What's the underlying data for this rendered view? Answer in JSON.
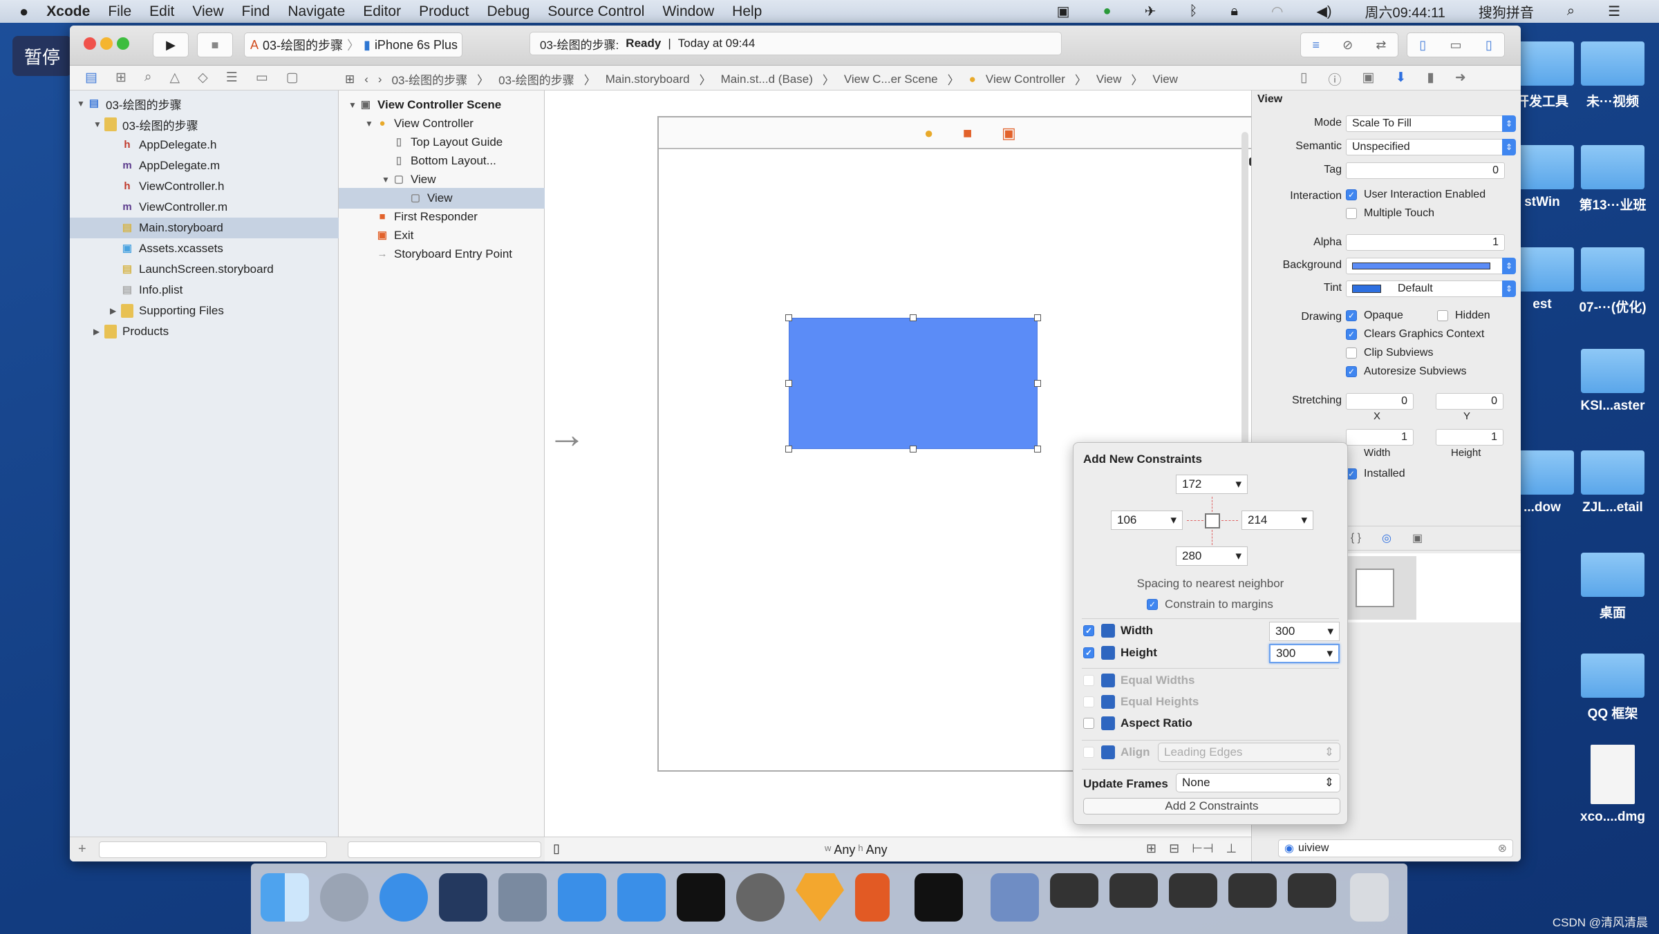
{
  "menubar": {
    "app": "Xcode",
    "items": [
      "File",
      "Edit",
      "View",
      "Find",
      "Navigate",
      "Editor",
      "Product",
      "Debug",
      "Source Control",
      "Window",
      "Help"
    ],
    "clock": "周六09:44:11",
    "input_method": "搜狗拼音"
  },
  "overlay": {
    "pause_label": "暂停"
  },
  "toolbar": {
    "scheme": "03-绘图的步骤",
    "device": "iPhone 6s Plus",
    "status_project": "03-绘图的步骤:",
    "status_state": "Ready",
    "status_time": "Today at 09:44"
  },
  "breadcrumb": [
    "03-绘图的步骤",
    "03-绘图的步骤",
    "Main.storyboard",
    "Main.st...d (Base)",
    "View C...er Scene",
    "View Controller",
    "View",
    "View"
  ],
  "navigator": {
    "items": [
      {
        "label": "03-绘图的步骤",
        "icon": "project-icon",
        "level": 0,
        "disclosure": "open"
      },
      {
        "label": "03-绘图的步骤",
        "icon": "folder-icon",
        "level": 1,
        "disclosure": "open"
      },
      {
        "label": "AppDelegate.h",
        "icon": "h-file-icon",
        "level": 2
      },
      {
        "label": "AppDelegate.m",
        "icon": "m-file-icon",
        "level": 2
      },
      {
        "label": "ViewController.h",
        "icon": "h-file-icon",
        "level": 2
      },
      {
        "label": "ViewController.m",
        "icon": "m-file-icon",
        "level": 2
      },
      {
        "label": "Main.storyboard",
        "icon": "storyboard-icon",
        "level": 2,
        "selected": true
      },
      {
        "label": "Assets.xcassets",
        "icon": "assets-icon",
        "level": 2
      },
      {
        "label": "LaunchScreen.storyboard",
        "icon": "storyboard-icon",
        "level": 2
      },
      {
        "label": "Info.plist",
        "icon": "plist-icon",
        "level": 2
      },
      {
        "label": "Supporting Files",
        "icon": "folder-icon",
        "level": 2,
        "disclosure": "closed"
      },
      {
        "label": "Products",
        "icon": "folder-icon",
        "level": 1,
        "disclosure": "closed"
      }
    ]
  },
  "outline": {
    "items": [
      {
        "label": "View Controller Scene",
        "level": 0,
        "disclosure": "open",
        "bold": true
      },
      {
        "label": "View Controller",
        "level": 1,
        "disclosure": "open"
      },
      {
        "label": "Top Layout Guide",
        "level": 2
      },
      {
        "label": "Bottom Layout...",
        "level": 2
      },
      {
        "label": "View",
        "level": 2,
        "disclosure": "open"
      },
      {
        "label": "View",
        "level": 3,
        "selected": true
      },
      {
        "label": "First Responder",
        "level": 1
      },
      {
        "label": "Exit",
        "level": 1
      },
      {
        "label": "Storyboard Entry Point",
        "level": 1
      }
    ]
  },
  "canvas": {
    "view_color": "#5b8cf7",
    "size_class_w": "Any",
    "size_class_h": "Any",
    "w_prefix": "w",
    "h_prefix": "h"
  },
  "inspector": {
    "section": "View",
    "mode_label": "Mode",
    "mode": "Scale To Fill",
    "semantic_label": "Semantic",
    "semantic": "Unspecified",
    "tag_label": "Tag",
    "tag": "0",
    "interaction_label": "Interaction",
    "user_interaction": "User Interaction Enabled",
    "multiple_touch": "Multiple Touch",
    "alpha_label": "Alpha",
    "alpha": "1",
    "background_label": "Background",
    "tint_label": "Tint",
    "tint": "Default",
    "drawing_label": "Drawing",
    "opaque": "Opaque",
    "hidden": "Hidden",
    "clears": "Clears Graphics Context",
    "clip": "Clip Subviews",
    "autoresize": "Autoresize Subviews",
    "stretching_label": "Stretching",
    "sx": "0",
    "sy": "0",
    "sw": "1",
    "sh": "1",
    "x_label": "X",
    "y_label": "Y",
    "w_label": "Width",
    "h_label": "Height",
    "installed": "Installed",
    "search": "uiview"
  },
  "constraints": {
    "title": "Add New Constraints",
    "top": "172",
    "left": "106",
    "right": "214",
    "bottom": "280",
    "spacing_label": "Spacing to nearest neighbor",
    "constrain_margins": "Constrain to margins",
    "width_label": "Width",
    "width": "300",
    "height_label": "Height",
    "height": "300",
    "equal_widths": "Equal Widths",
    "equal_heights": "Equal Heights",
    "aspect": "Aspect Ratio",
    "align_label": "Align",
    "align_value": "Leading Edges",
    "update_label": "Update Frames",
    "update_value": "None",
    "add_button": "Add 2 Constraints"
  },
  "desktop": {
    "items": [
      "开发工具",
      "未···视频",
      "stWin",
      "第13···业班",
      "est",
      "07-···(优化)",
      "KSI...aster",
      "...dow",
      "ZJL...etail",
      "桌面",
      "QQ 框架",
      "xco....dmg"
    ]
  },
  "watermark": "CSDN @清风清晨"
}
